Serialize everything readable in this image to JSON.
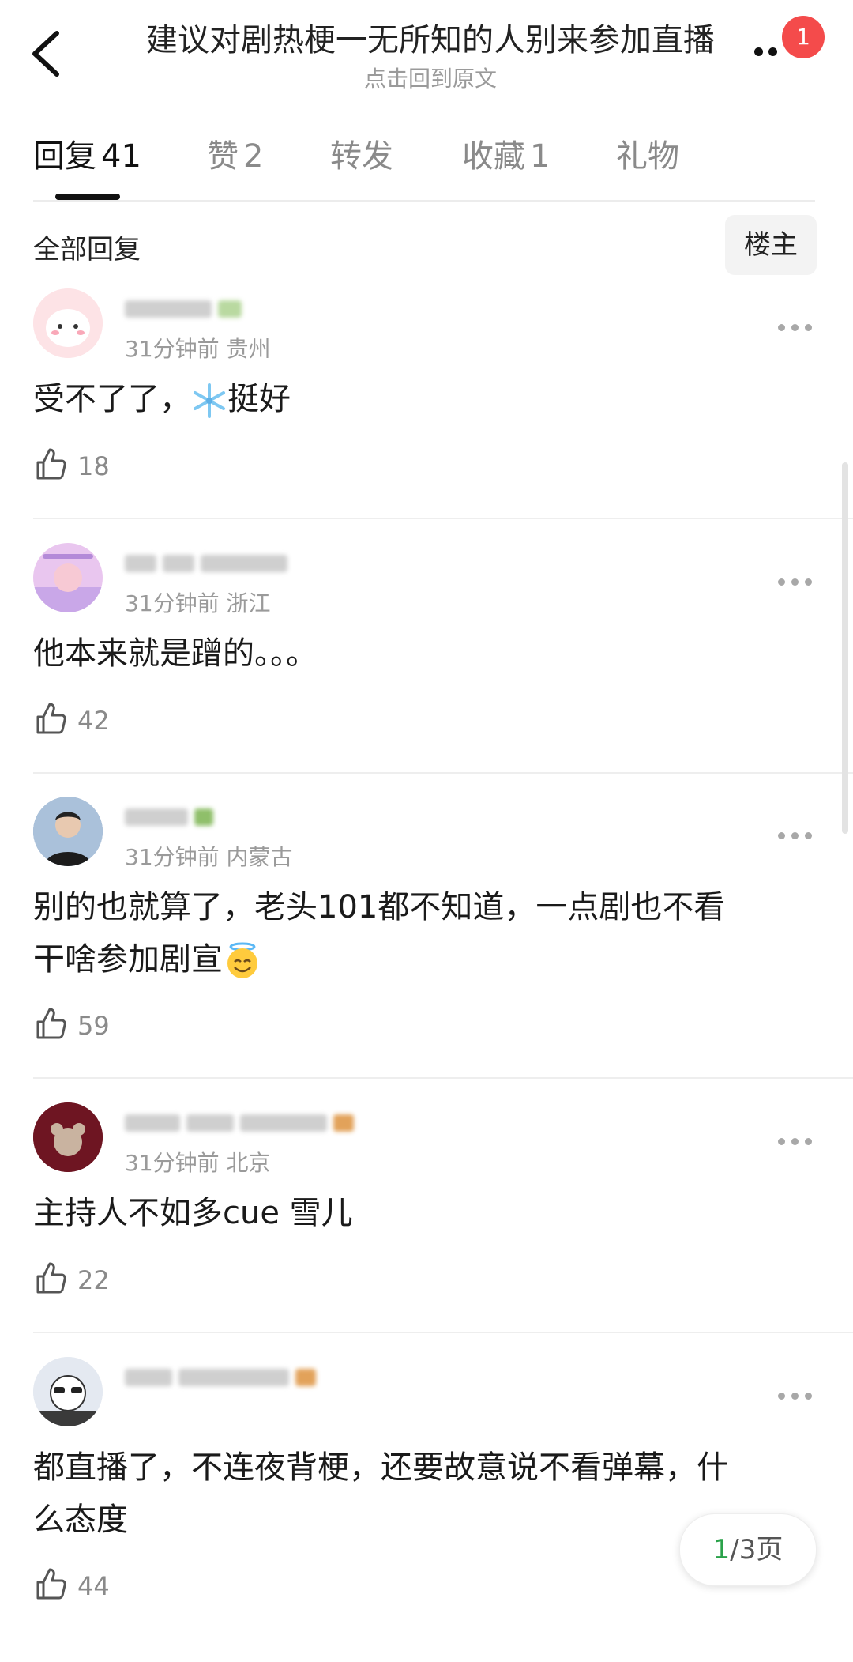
{
  "header": {
    "title": "建议对剧热梗一无所知的人别来参加直播",
    "subtitle": "点击回到原文",
    "badge_count": "1"
  },
  "tabs": [
    {
      "label": "回复",
      "count": "41"
    },
    {
      "label": "赞",
      "count": "2"
    },
    {
      "label": "转发",
      "count": ""
    },
    {
      "label": "收藏",
      "count": "1"
    },
    {
      "label": "礼物",
      "count": ""
    }
  ],
  "filter": {
    "label": "全部回复",
    "owner_button": "楼主"
  },
  "comments": [
    {
      "time": "31分钟前",
      "location": "贵州",
      "text_before": "受不了了，",
      "emoji": "snowflake",
      "text_after": "挺好",
      "likes": "18"
    },
    {
      "time": "31分钟前",
      "location": "浙江",
      "text": "他本来就是蹭的。。。",
      "likes": "42"
    },
    {
      "time": "31分钟前",
      "location": "内蒙古",
      "text_line1": "别的也就算了，老头101都不知道，一点剧也不看",
      "text_line2": "干啥参加剧宣",
      "emoji": "smiling-face-with-halo",
      "likes": "59"
    },
    {
      "time": "31分钟前",
      "location": "北京",
      "text": "主持人不如多cue 雪儿",
      "likes": "22"
    },
    {
      "time": "",
      "location": "",
      "text_line1": "都直播了，不连夜背梗，还要故意说不看弹幕，什",
      "text_line2": "么态度",
      "likes": "44"
    }
  ],
  "pager": {
    "current": "1",
    "rest": "/3页"
  },
  "colors": {
    "accent_green": "#2aa24a",
    "badge_red": "#f44b4b"
  }
}
